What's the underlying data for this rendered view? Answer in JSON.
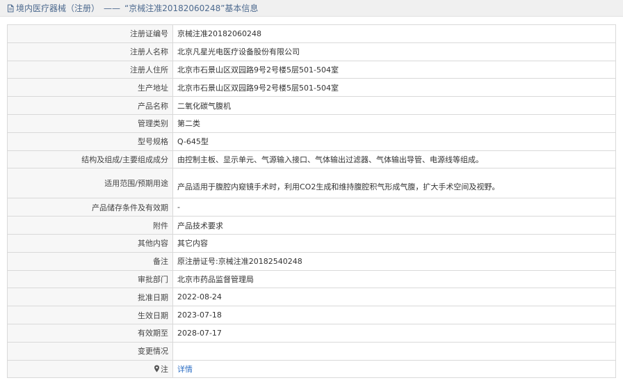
{
  "header": {
    "category": "境内医疗器械（注册）",
    "separator": "——",
    "title": "“京械注准20182060248”基本信息",
    "icon": "document-icon"
  },
  "rows": [
    {
      "label": "注册证编号",
      "value": "京械注准20182060248"
    },
    {
      "label": "注册人名称",
      "value": "北京凡星光电医疗设备股份有限公司"
    },
    {
      "label": "注册人住所",
      "value": "北京市石景山区双园路9号2号楼5层501-504室"
    },
    {
      "label": "生产地址",
      "value": "北京市石景山区双园路9号2号楼5层501-504室"
    },
    {
      "label": "产品名称",
      "value": "二氧化碳气腹机"
    },
    {
      "label": "管理类别",
      "value": "第二类"
    },
    {
      "label": "型号规格",
      "value": "Q-645型"
    },
    {
      "label": "结构及组成/主要组成成分",
      "value": "由控制主板、显示单元、气源输入接口、气体输出过滤器、气体输出导管、电源线等组成。"
    },
    {
      "label": "适用范围/预期用途",
      "value": "产品适用于腹腔内窥镜手术时，利用CO2生成和维持腹腔积气形成气腹，扩大手术空间及视野。"
    },
    {
      "label": "产品储存条件及有效期",
      "value": "-"
    },
    {
      "label": "附件",
      "value": "产品技术要求"
    },
    {
      "label": "其他内容",
      "value": "其它内容"
    },
    {
      "label": "备注",
      "value": "原注册证号:京械注准20182540248"
    },
    {
      "label": "审批部门",
      "value": "北京市药品监督管理局"
    },
    {
      "label": "批准日期",
      "value": "2022-08-24"
    },
    {
      "label": "生效日期",
      "value": "2023-07-18"
    },
    {
      "label": "有效期至",
      "value": "2028-07-17"
    },
    {
      "label": "变更情况",
      "value": ""
    }
  ],
  "note_row": {
    "label": "注",
    "icon": "map-pin-icon",
    "link_text": "详情"
  },
  "colors": {
    "header_bg": "#f0f0f0",
    "header_text": "#4d6a8f",
    "label_bg": "#f7f7f7",
    "border": "#d9d9d9",
    "link": "#2e6fc4"
  }
}
